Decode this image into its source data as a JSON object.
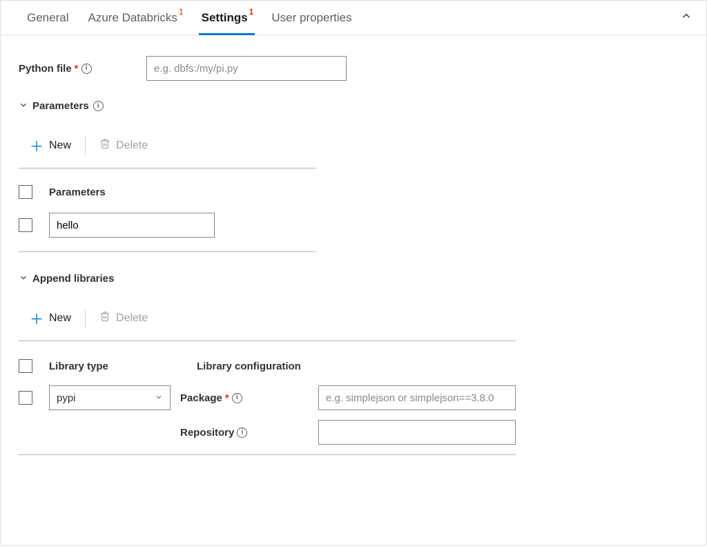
{
  "tabs": {
    "general": "General",
    "databricks": "Azure Databricks",
    "databricks_badge": "1",
    "settings": "Settings",
    "settings_badge": "1",
    "user_props": "User properties"
  },
  "python_file": {
    "label": "Python file",
    "placeholder": "e.g. dbfs:/my/pi.py",
    "value": ""
  },
  "parameters": {
    "title": "Parameters",
    "new_label": "New",
    "delete_label": "Delete",
    "column_header": "Parameters",
    "rows": [
      {
        "value": "hello"
      }
    ]
  },
  "libraries": {
    "title": "Append libraries",
    "new_label": "New",
    "delete_label": "Delete",
    "col_type": "Library type",
    "col_conf": "Library configuration",
    "rows": [
      {
        "type": "pypi",
        "package_label": "Package",
        "package_placeholder": "e.g. simplejson or simplejson==3.8.0",
        "package_value": "",
        "repo_label": "Repository",
        "repo_value": ""
      }
    ]
  }
}
